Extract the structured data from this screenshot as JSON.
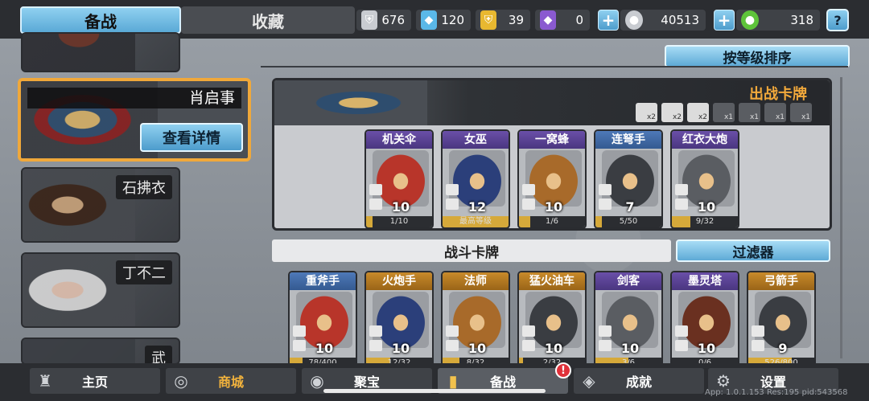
{
  "tabs": {
    "prepare": "备战",
    "collection": "收藏"
  },
  "resources": [
    {
      "icon": "silver-shield-icon",
      "value": "676",
      "color": "#c9ccd1"
    },
    {
      "icon": "blue-crystal-icon",
      "value": "120",
      "color": "#5ab8e8"
    },
    {
      "icon": "gold-shield-icon",
      "value": "39",
      "color": "#e8b830"
    },
    {
      "icon": "purple-crystal-icon",
      "value": "0",
      "color": "#8a5ad0"
    },
    {
      "icon": "silver-coin-icon",
      "value": "40513",
      "color": "#c9ccd1"
    },
    {
      "icon": "green-gem-icon",
      "value": "318",
      "color": "#5ec43a"
    }
  ],
  "help_label": "?",
  "plus_label": "+",
  "heroes": [
    {
      "name": ""
    },
    {
      "name": "肖启事",
      "detail_label": "查看详情"
    },
    {
      "name": "石拂衣"
    },
    {
      "name": "丁不二"
    },
    {
      "name": "武"
    }
  ],
  "sort_label": "按等级排序",
  "battle_cards_title": "出战卡牌",
  "skills": [
    {
      "icon": "sword-skill-icon",
      "count": "x2",
      "active": true
    },
    {
      "icon": "rider-skill-icon",
      "count": "x2",
      "active": true
    },
    {
      "icon": "burst-skill-icon",
      "count": "x2",
      "active": true
    },
    {
      "icon": "fist-skill-icon",
      "count": "x1",
      "active": false
    },
    {
      "icon": "tower-skill-icon",
      "count": "x1",
      "active": false
    },
    {
      "icon": "gear-skill-icon",
      "count": "x1",
      "active": false
    },
    {
      "icon": "wall-skill-icon",
      "count": "x1",
      "active": false
    }
  ],
  "deck_cards": [
    {
      "name": "机关伞",
      "level": "10",
      "progress": "1/10",
      "ratio": 0.1,
      "rarity": "purple"
    },
    {
      "name": "女巫",
      "level": "12",
      "progress": "最高等级",
      "ratio": 1.0,
      "rarity": "purple"
    },
    {
      "name": "一窝蜂",
      "level": "10",
      "progress": "1/6",
      "ratio": 0.17,
      "rarity": "purple"
    },
    {
      "name": "连弩手",
      "level": "7",
      "progress": "5/50",
      "ratio": 0.1,
      "rarity": "blue"
    },
    {
      "name": "红衣大炮",
      "level": "10",
      "progress": "9/32",
      "ratio": 0.28,
      "rarity": "purple"
    }
  ],
  "battle_cards_section": "战斗卡牌",
  "filter_label": "过滤器",
  "collection_cards": [
    {
      "name": "重斧手",
      "level": "10",
      "progress": "78/400",
      "ratio": 0.2,
      "rarity": "blue"
    },
    {
      "name": "火炮手",
      "level": "10",
      "progress": "12/32",
      "ratio": 0.37,
      "rarity": "orange"
    },
    {
      "name": "法师",
      "level": "10",
      "progress": "8/32",
      "ratio": 0.25,
      "rarity": "orange"
    },
    {
      "name": "猛火油车",
      "level": "10",
      "progress": "2/32",
      "ratio": 0.06,
      "rarity": "orange"
    },
    {
      "name": "剑客",
      "level": "10",
      "progress": "3/6",
      "ratio": 0.5,
      "rarity": "purple"
    },
    {
      "name": "墨灵塔",
      "level": "10",
      "progress": "0/6",
      "ratio": 0.0,
      "rarity": "purple"
    },
    {
      "name": "弓箭手",
      "level": "9",
      "progress": "526/800",
      "ratio": 0.66,
      "rarity": "orange"
    }
  ],
  "nav": [
    {
      "label": "主页",
      "icon": "castle-icon"
    },
    {
      "label": "商城",
      "icon": "coins-icon"
    },
    {
      "label": "聚宝",
      "icon": "treasure-icon"
    },
    {
      "label": "备战",
      "icon": "cards-icon"
    },
    {
      "label": "成就",
      "icon": "achievement-icon"
    },
    {
      "label": "设置",
      "icon": "gear-icon"
    }
  ],
  "badge": "!",
  "version_text": "App: 1.0.1.153 Res:195 pid:543568"
}
